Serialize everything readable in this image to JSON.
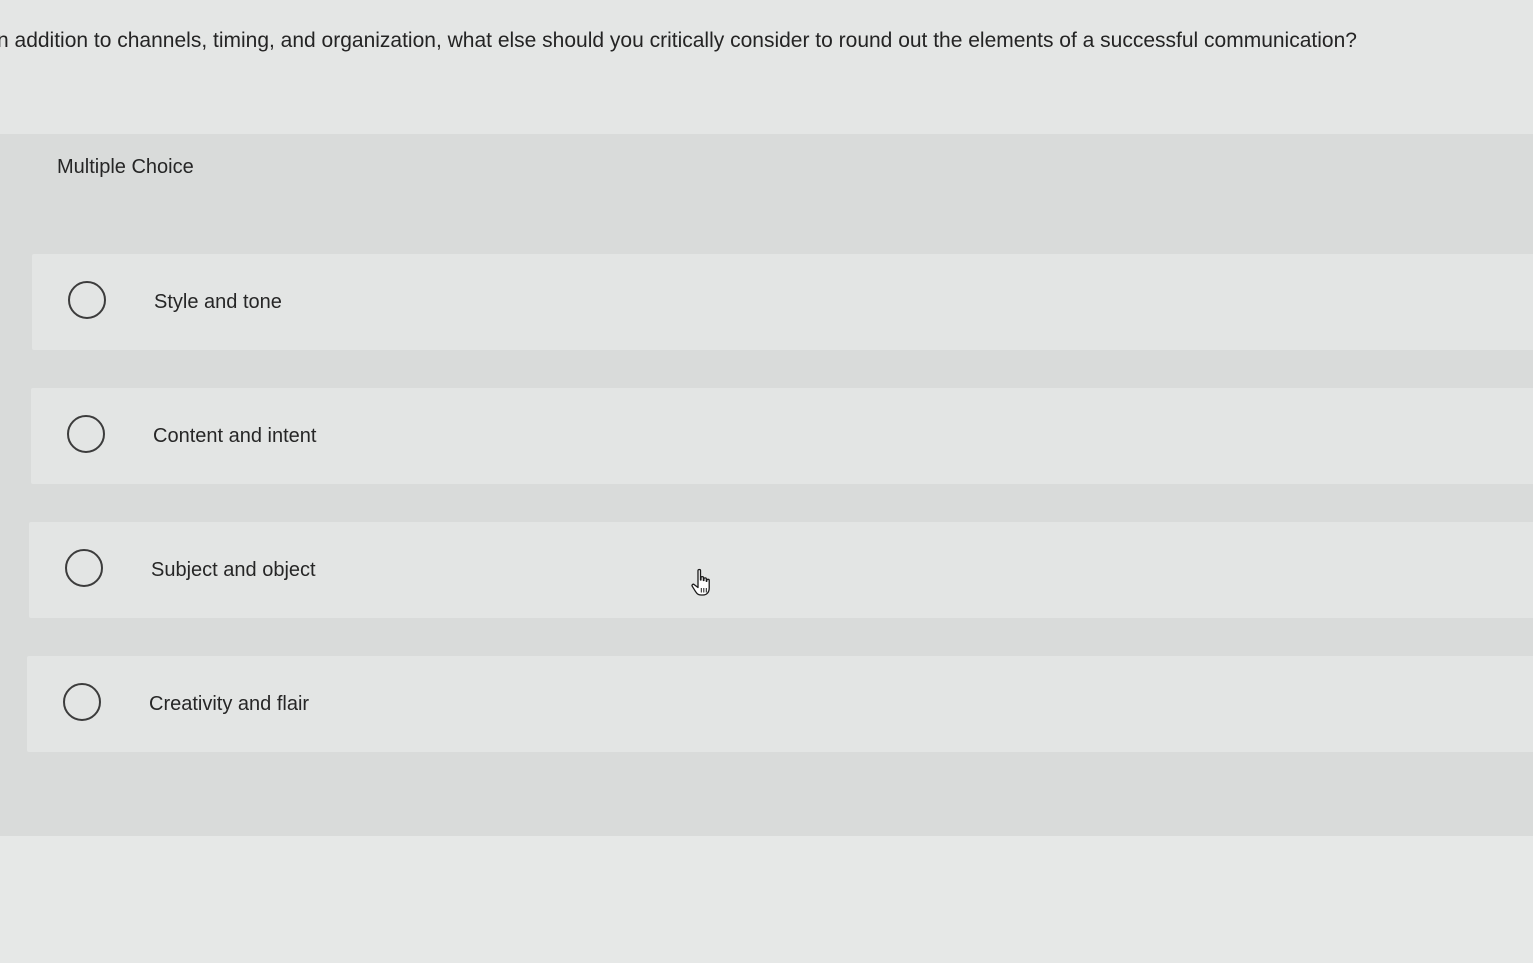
{
  "question": {
    "text": "n addition to channels, timing, and organization, what else should you critically consider to round out the elements of a successful communication?"
  },
  "panel": {
    "label": "Multiple Choice"
  },
  "options": [
    {
      "label": "Style and tone",
      "selected": false
    },
    {
      "label": "Content and intent",
      "selected": false
    },
    {
      "label": "Subject and object",
      "selected": false
    },
    {
      "label": "Creativity and flair",
      "selected": false
    }
  ],
  "cursor": {
    "icon": "hand-pointer-icon"
  }
}
